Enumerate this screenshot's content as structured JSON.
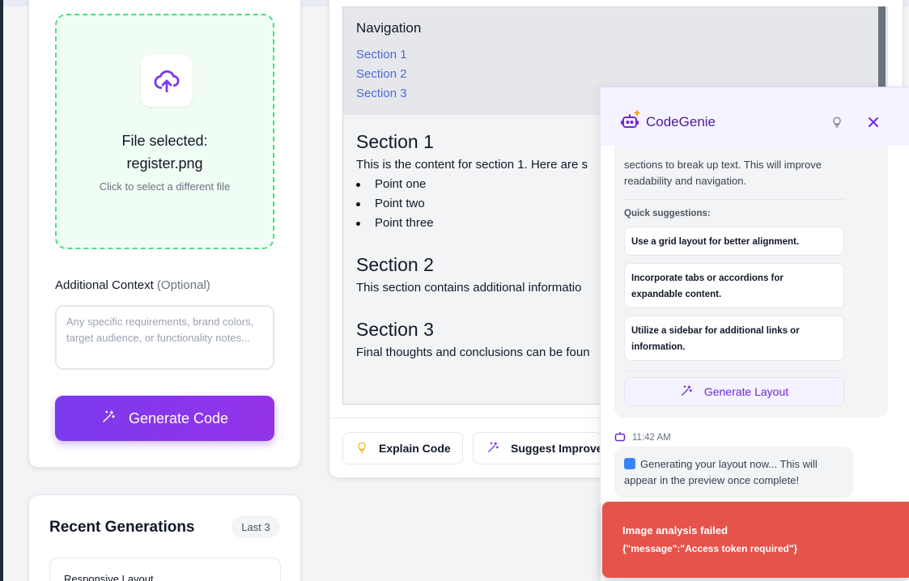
{
  "upload": {
    "file_title_line1": "File selected:",
    "file_title_line2": "register.png",
    "file_sub": "Click to select a different file",
    "context_label": "Additional Context",
    "context_optional": "(Optional)",
    "context_placeholder": "Any specific requirements, brand colors, target audience, or functionality notes...",
    "generate_label": "Generate Code"
  },
  "recent": {
    "title": "Recent Generations",
    "badge": "Last 3",
    "first_item": "Responsive Layout"
  },
  "preview": {
    "nav_title": "Navigation",
    "nav_links": [
      "Section 1",
      "Section 2",
      "Section 3"
    ],
    "sections": [
      {
        "title": "Section 1",
        "text": "This is the content for section 1. Here are s"
      },
      {
        "title": "Section 2",
        "text": "This section contains additional informatio"
      },
      {
        "title": "Section 3",
        "text": "Final thoughts and conclusions can be foun"
      }
    ],
    "bullets": [
      "Point one",
      "Point two",
      "Point three"
    ],
    "explain_label": "Explain Code",
    "suggest_label": "Suggest Improve"
  },
  "genie": {
    "title": "CodeGenie",
    "bubble_text": "sections to break up text. This will improve readability and navigation.",
    "quick_label": "Quick suggestions:",
    "suggestions": [
      "Use a grid layout for better alignment.",
      "Incorporate tabs or accordions for expandable content.",
      "Utilize a sidebar for additional links or information."
    ],
    "layout_button": "Generate Layout",
    "timestamp": "11:42 AM",
    "message": "Generating your layout now... This will appear in the preview once complete!"
  },
  "toast": {
    "title": "Image analysis failed",
    "message": "{\"message\":\"Access token required\"}"
  },
  "colors": {
    "accent": "#7c3aed",
    "success_border": "#4ade80",
    "link": "#4f6bd8",
    "error": "#e5534b"
  }
}
